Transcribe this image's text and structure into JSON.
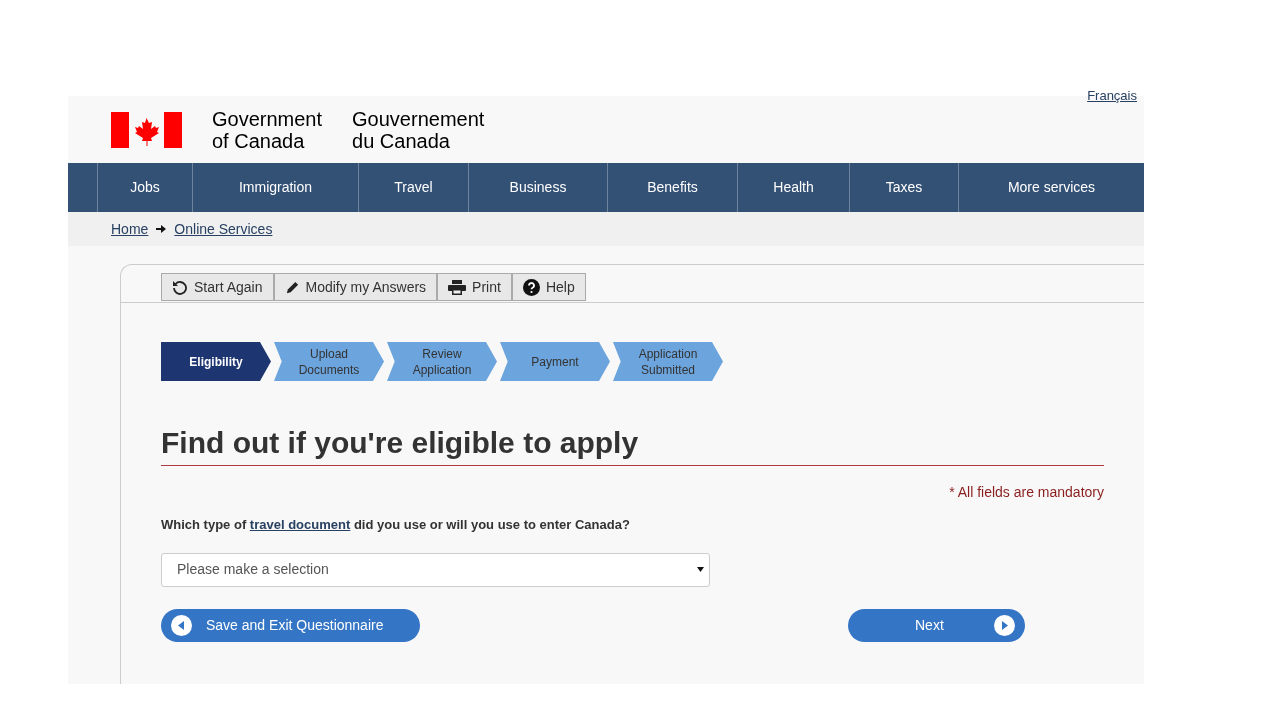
{
  "language_link": "Français",
  "header": {
    "title_en": [
      "Government",
      "of Canada"
    ],
    "title_fr": [
      "Gouvernement",
      "du Canada"
    ]
  },
  "nav": [
    "Jobs",
    "Immigration",
    "Travel",
    "Business",
    "Benefits",
    "Health",
    "Taxes",
    "More services"
  ],
  "breadcrumb": [
    "Home",
    "Online Services"
  ],
  "toolbar": [
    {
      "label": "Start Again",
      "kind": "restart"
    },
    {
      "label": "Modify my Answers",
      "kind": "edit"
    },
    {
      "label": "Print",
      "kind": "print"
    },
    {
      "label": "Help",
      "kind": "help"
    }
  ],
  "steps": [
    {
      "label": "Eligibility",
      "selected": true
    },
    {
      "label": "Upload Documents",
      "selected": false
    },
    {
      "label": "Review Application",
      "selected": false
    },
    {
      "label": "Payment",
      "selected": false
    },
    {
      "label": "Application Submitted",
      "selected": false
    }
  ],
  "heading": "Find out if you're eligible to apply",
  "mandatory_note": "* All fields are mandatory",
  "question": {
    "before": "Which type of",
    "link": "travel document",
    "after": "did you use or will you use to enter Canada?"
  },
  "select": {
    "placeholder": "Please make a selection"
  },
  "buttons": {
    "back": "Save and Exit Questionnaire",
    "next": "Next"
  }
}
